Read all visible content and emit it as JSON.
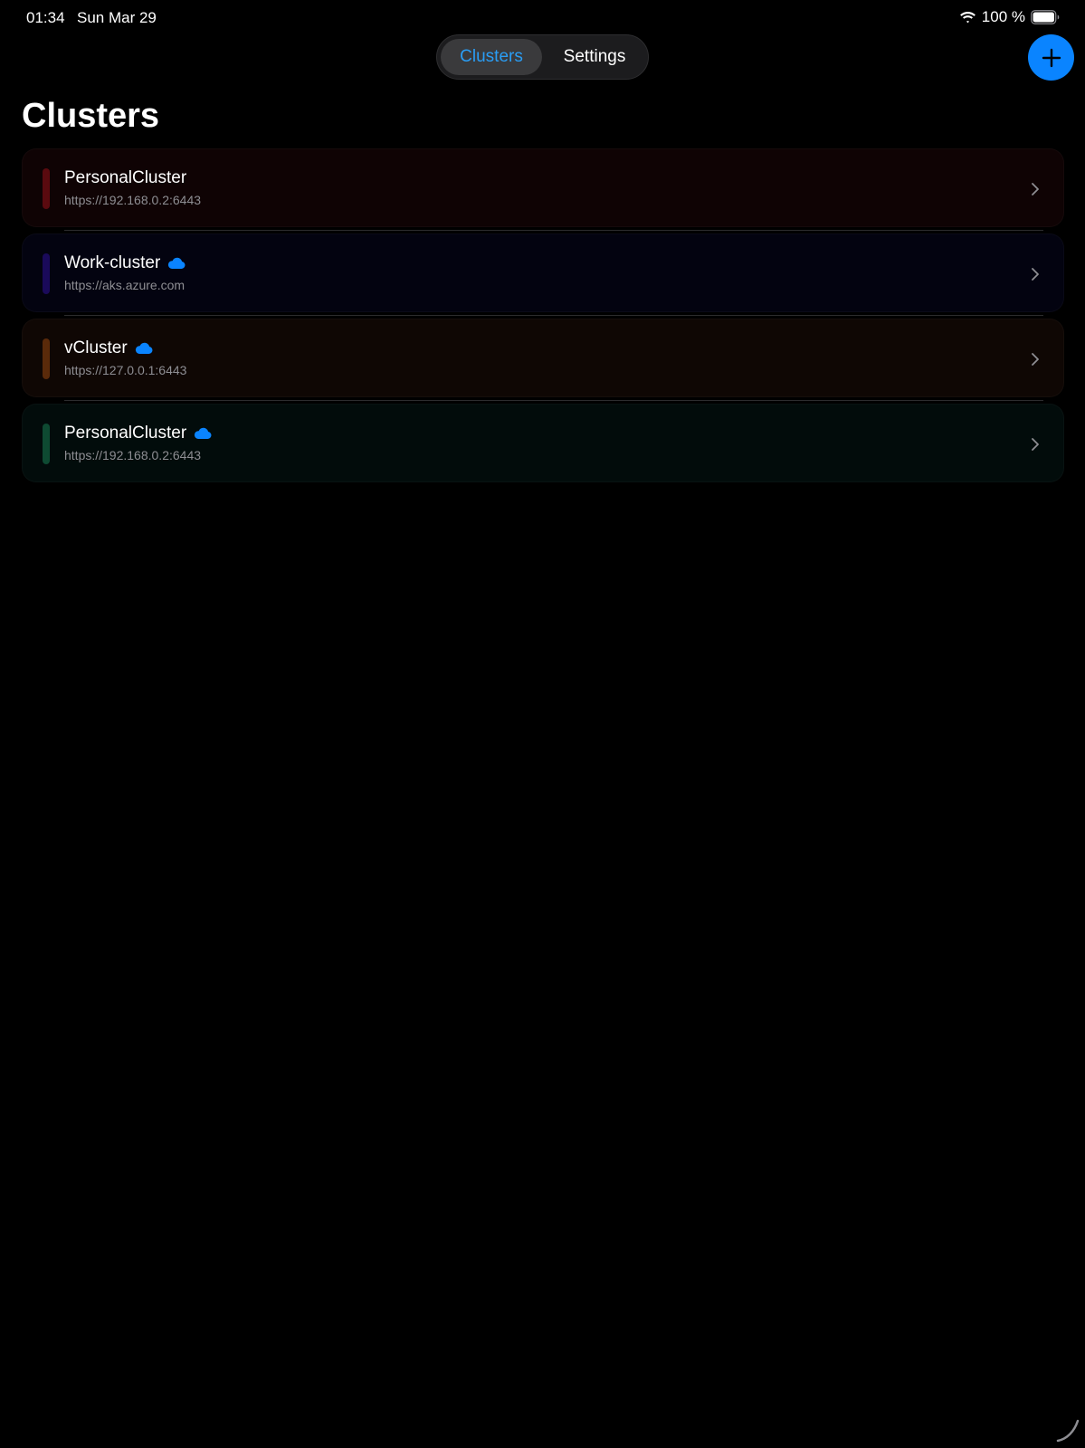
{
  "status_bar": {
    "time": "01:34",
    "date": "Sun Mar 29",
    "battery_percent": "100 %",
    "battery_level": 1.0
  },
  "nav": {
    "tabs": [
      {
        "label": "Clusters",
        "selected": true
      },
      {
        "label": "Settings",
        "selected": false
      }
    ],
    "add_icon": "plus-icon"
  },
  "page": {
    "title": "Clusters"
  },
  "clusters": [
    {
      "name": "PersonalCluster",
      "url": "https://192.168.0.2:6443",
      "synced": false,
      "color": "#5a0a0f",
      "tint": "#0f0304"
    },
    {
      "name": "Work-cluster",
      "url": "https://aks.azure.com",
      "synced": true,
      "color": "#1a0a5a",
      "tint": "#030310"
    },
    {
      "name": "vCluster",
      "url": "https://127.0.0.1:6443",
      "synced": true,
      "color": "#5a2a0a",
      "tint": "#0f0704"
    },
    {
      "name": "PersonalCluster",
      "url": "https://192.168.0.2:6443",
      "synced": true,
      "color": "#0e4a32",
      "tint": "#020c0b"
    }
  ],
  "colors": {
    "accent": "#0a84ff",
    "selected_tab_text": "#2a9df4",
    "secondary_text": "#8e8e93",
    "background": "#000000"
  }
}
